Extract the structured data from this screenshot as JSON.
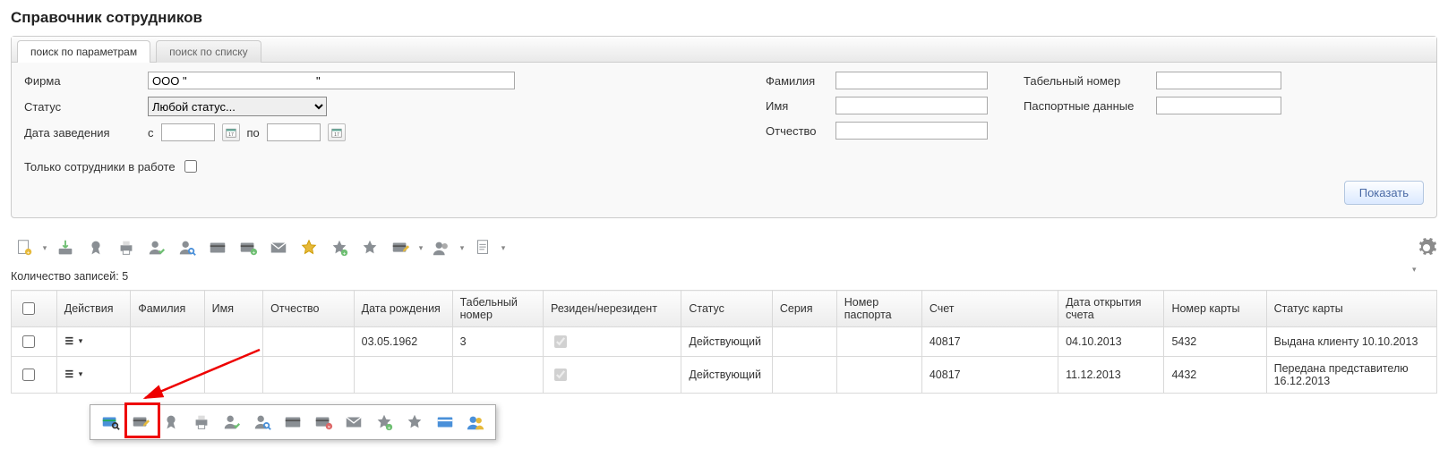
{
  "title": "Справочник сотрудников",
  "tabs": {
    "params": "поиск по параметрам",
    "list": "поиск по списку"
  },
  "form": {
    "firm_label": "Фирма",
    "firm_value": "ООО \"                                        \"",
    "status_label": "Статус",
    "status_value": "Любой статус...",
    "date_label": "Дата заведения",
    "date_from": "с",
    "date_to": "по",
    "only_active": "Только сотрудники в работе",
    "lastname": "Фамилия",
    "firstname": "Имя",
    "middlename": "Отчество",
    "tabnum": "Табельный номер",
    "passport": "Паспортные данные",
    "show": "Показать"
  },
  "count_label": "Количество записей:",
  "count_value": "5",
  "columns": [
    "Действия",
    "Фамилия",
    "Имя",
    "Отчество",
    "Дата рождения",
    "Табельный номер",
    "Резиден/нерезидент",
    "Статус",
    "Серия",
    "Номер паспорта",
    "Счет",
    "Дата открытия счета",
    "Номер карты",
    "Статус карты"
  ],
  "rows": [
    {
      "dob": "03.05.1962",
      "tab": "3",
      "resident": true,
      "status": "Действующий",
      "series": "",
      "passno": "",
      "account": "40817",
      "opened": "04.10.2013",
      "card": "5432",
      "cardstatus": "Выдана клиенту 10.10.2013"
    },
    {
      "dob": "",
      "tab": "",
      "resident": true,
      "status": "Действующий",
      "series": "",
      "passno": "",
      "account": "40817",
      "opened": "11.12.2013",
      "card": "4432",
      "cardstatus": "Передана представителю 16.12.2013"
    }
  ],
  "toolbar_icons": [
    "new-doc-icon",
    "import-icon",
    "award-icon",
    "print-icon",
    "user-check-icon",
    "user-search-icon",
    "card-icon",
    "card-add-icon",
    "envelope-icon",
    "star-fav-icon",
    "star-plus-icon",
    "star-grey-icon",
    "card-edit-icon",
    "users-icon",
    "doc-more-icon"
  ],
  "popup_icons": [
    "card-view-icon",
    "card-edit-icon",
    "award-icon",
    "print-icon",
    "user-check-icon",
    "user-search-icon",
    "card-icon",
    "card-delete-icon",
    "envelope-icon",
    "star-plus-icon",
    "star-grey-icon",
    "card-blue-icon",
    "users-color-icon"
  ]
}
